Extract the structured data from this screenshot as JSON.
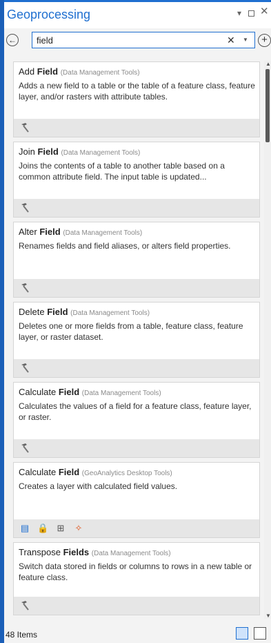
{
  "panel": {
    "title": "Geoprocessing"
  },
  "search": {
    "value": "field"
  },
  "tools": [
    {
      "name_prefix": "Add ",
      "name_bold": "Field",
      "category": "(Data Management Tools)",
      "description": "Adds a new field to a table or the table of a feature class, feature layer, and/or rasters with attribute tables.",
      "icons": [
        "hammer-icon"
      ]
    },
    {
      "name_prefix": "Join ",
      "name_bold": "Field",
      "category": "(Data Management Tools)",
      "description": "Joins the contents of a table to another table based on a common attribute field. The input table is updated...",
      "icons": [
        "hammer-icon"
      ]
    },
    {
      "name_prefix": "Alter ",
      "name_bold": "Field",
      "category": "(Data Management Tools)",
      "description": "Renames fields and field aliases, or alters field properties.",
      "icons": [
        "hammer-icon"
      ]
    },
    {
      "name_prefix": "Delete ",
      "name_bold": "Field",
      "category": "(Data Management Tools)",
      "description": "Deletes one or more fields from a table, feature class, feature layer, or raster dataset.",
      "icons": [
        "hammer-icon"
      ]
    },
    {
      "name_prefix": "Calculate ",
      "name_bold": "Field",
      "category": "(Data Management Tools)",
      "description": "Calculates the values of a field for a feature class, feature layer, or raster.",
      "icons": [
        "hammer-icon"
      ]
    },
    {
      "name_prefix": "Calculate ",
      "name_bold": "Field",
      "category": "(GeoAnalytics Desktop Tools)",
      "description": "Creates a layer with calculated field values.",
      "icons": [
        "script-icon",
        "lock-icon",
        "model-icon",
        "geoanalytics-icon"
      ]
    },
    {
      "name_prefix": "Transpose ",
      "name_bold": "Fields",
      "category": "(Data Management Tools)",
      "description": "Switch  data stored in fields or columns to rows in a new table or feature class.",
      "icons": [
        "hammer-icon"
      ]
    }
  ],
  "status": {
    "count": "48 Items"
  },
  "colors": {
    "accent": "#1f6fd0",
    "frame": "#1b5fb8"
  }
}
